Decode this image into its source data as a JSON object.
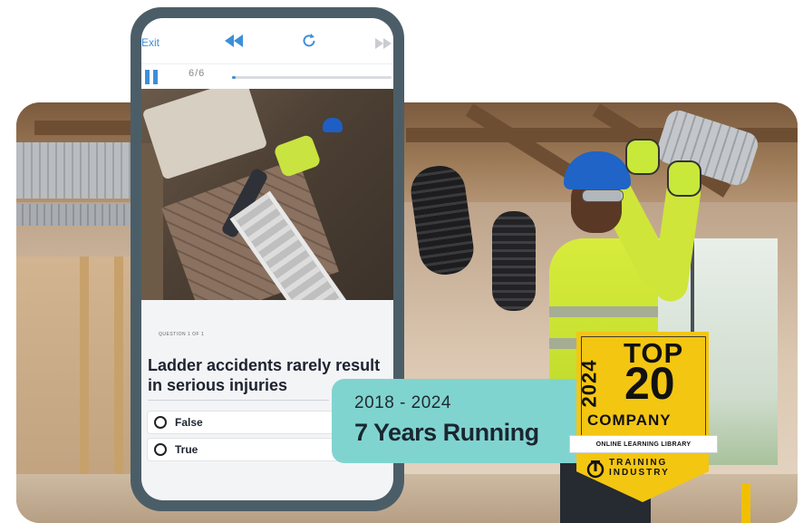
{
  "phone": {
    "topbar": {
      "exit_label": "Exit"
    },
    "controls": {
      "counter": "6/6",
      "progress": 0.02
    },
    "question": {
      "label": "QUESTION 1 OF 1",
      "text": "Ladder accidents rarely result in serious injuries",
      "options": [
        "False",
        "True"
      ]
    }
  },
  "banner": {
    "years": "2018 - 2024",
    "headline": "7 Years Running"
  },
  "badge": {
    "year": "2024",
    "top": "TOP",
    "number": "20",
    "company": "COMPANY",
    "ribbon": "ONLINE LEARNING LIBRARY",
    "org_line1": "TRAINING",
    "org_line2": "INDUSTRY"
  },
  "colors": {
    "accent": "#3c8fd8",
    "phone_frame": "#4b5e68",
    "banner": "#80d4d0",
    "badge": "#f3c612",
    "hi_vis": "#cfe53a",
    "helmet": "#1f64c6"
  },
  "icons": [
    "rewind-icon",
    "restart-icon",
    "fast-forward-icon",
    "pause-icon",
    "radio-icon",
    "training-industry-logo-icon"
  ]
}
